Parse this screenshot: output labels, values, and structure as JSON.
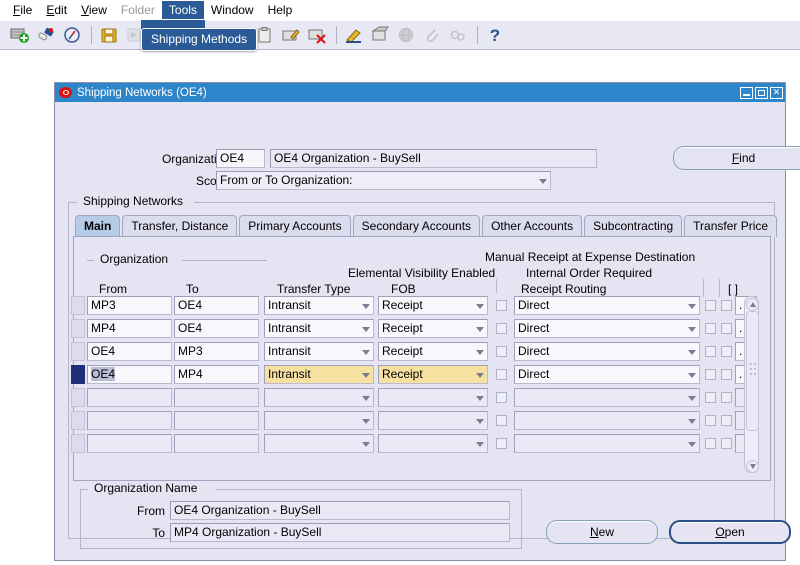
{
  "menubar": {
    "items": [
      {
        "label": "File",
        "state": "normal"
      },
      {
        "label": "Edit",
        "state": "normal"
      },
      {
        "label": "View",
        "state": "normal"
      },
      {
        "label": "Folder",
        "state": "disabled"
      },
      {
        "label": "Tools",
        "state": "active"
      },
      {
        "label": "Window",
        "state": "normal"
      },
      {
        "label": "Help",
        "state": "normal"
      }
    ]
  },
  "tooltip": {
    "text": "Shipping Methods"
  },
  "toolbar": {
    "buttons": [
      {
        "name": "new-record-icon",
        "glyph": "➕",
        "disabled": false
      },
      {
        "name": "find-flashlight-icon",
        "glyph": "ὒ6",
        "disabled": false
      },
      {
        "name": "show-navigator-icon",
        "glyph": "◔",
        "disabled": false
      },
      {
        "name": "separator",
        "glyph": "",
        "disabled": false
      },
      {
        "name": "save-icon",
        "glyph": "ὋE",
        "disabled": false
      },
      {
        "name": "next-step-icon",
        "glyph": "⏩",
        "disabled": true
      },
      {
        "name": "print-icon",
        "glyph": "὚8",
        "disabled": true
      },
      {
        "name": "close-form-icon",
        "glyph": "✖",
        "disabled": true
      },
      {
        "name": "cut-icon",
        "glyph": "✂",
        "disabled": false
      },
      {
        "name": "copy-icon",
        "glyph": "Ὅ1",
        "disabled": false
      },
      {
        "name": "paste-icon",
        "glyph": "ὌB",
        "disabled": false
      },
      {
        "name": "edit-record-icon",
        "glyph": "✏",
        "disabled": false
      },
      {
        "name": "delete-record-icon",
        "glyph": "✖",
        "disabled": false
      },
      {
        "name": "separator",
        "glyph": "",
        "disabled": false
      },
      {
        "name": "edit-field-icon",
        "glyph": "὘A",
        "disabled": false
      },
      {
        "name": "zoom-icon",
        "glyph": "ὐD",
        "disabled": false
      },
      {
        "name": "translations-icon",
        "glyph": "ἱ0",
        "disabled": true
      },
      {
        "name": "attachments-icon",
        "glyph": "ὌE",
        "disabled": true
      },
      {
        "name": "folder-tools-icon",
        "glyph": "⚙",
        "disabled": true
      },
      {
        "name": "separator",
        "glyph": "",
        "disabled": false
      },
      {
        "name": "help-icon",
        "glyph": "?",
        "disabled": false
      }
    ]
  },
  "window": {
    "title": "Shipping Networks (OE4)",
    "controls": {
      "minimize": "–",
      "maximize": "□",
      "close": "✕"
    }
  },
  "header": {
    "organization_label": "Organization",
    "organization_code": "OE4",
    "organization_name": "OE4 Organization - BuySell",
    "scope_label": "Scope",
    "scope_value": "From or To Organization:",
    "find_button": "Find"
  },
  "shipping_networks": {
    "group_title": "Shipping Networks",
    "tabs": [
      {
        "label": "Main",
        "selected": true
      },
      {
        "label": "Transfer, Distance",
        "selected": false
      },
      {
        "label": "Primary Accounts",
        "selected": false
      },
      {
        "label": "Secondary Accounts",
        "selected": false
      },
      {
        "label": "Other Accounts",
        "selected": false
      },
      {
        "label": "Subcontracting",
        "selected": false
      },
      {
        "label": "Transfer Price",
        "selected": false
      }
    ]
  },
  "grid": {
    "org_group_title": "Organization",
    "banner_line1": "Manual Receipt at Expense Destination",
    "banner_line2_left": "Elemental Visibility Enabled",
    "banner_line2_right": "Internal Order Required",
    "columns": {
      "from": "From",
      "to": "To",
      "transfer_type": "Transfer Type",
      "fob": "FOB",
      "receipt_routing": "Receipt Routing",
      "flex": "[ ]"
    },
    "rows": [
      {
        "from": "MP3",
        "to": "OE4",
        "transfer_type": "Intransit",
        "fob": "Receipt",
        "elemental_visibility": false,
        "receipt_routing": "Direct",
        "manual_receipt": false,
        "internal_order": false,
        "flex": ".",
        "current": false,
        "highlighted": false
      },
      {
        "from": "MP4",
        "to": "OE4",
        "transfer_type": "Intransit",
        "fob": "Receipt",
        "elemental_visibility": false,
        "receipt_routing": "Direct",
        "manual_receipt": false,
        "internal_order": false,
        "flex": ".",
        "current": false,
        "highlighted": false
      },
      {
        "from": "OE4",
        "to": "MP3",
        "transfer_type": "Intransit",
        "fob": "Receipt",
        "elemental_visibility": false,
        "receipt_routing": "Direct",
        "manual_receipt": false,
        "internal_order": false,
        "flex": ".",
        "current": false,
        "highlighted": false
      },
      {
        "from": "OE4",
        "to": "MP4",
        "transfer_type": "Intransit",
        "fob": "Receipt",
        "elemental_visibility": false,
        "receipt_routing": "Direct",
        "manual_receipt": false,
        "internal_order": false,
        "flex": ".",
        "current": true,
        "highlighted": true
      },
      {
        "from": "",
        "to": "",
        "transfer_type": "",
        "fob": "",
        "elemental_visibility": false,
        "receipt_routing": "",
        "manual_receipt": false,
        "internal_order": false,
        "flex": "",
        "current": false,
        "highlighted": false
      },
      {
        "from": "",
        "to": "",
        "transfer_type": "",
        "fob": "",
        "elemental_visibility": false,
        "receipt_routing": "",
        "manual_receipt": false,
        "internal_order": false,
        "flex": "",
        "current": false,
        "highlighted": false
      },
      {
        "from": "",
        "to": "",
        "transfer_type": "",
        "fob": "",
        "elemental_visibility": false,
        "receipt_routing": "",
        "manual_receipt": false,
        "internal_order": false,
        "flex": "",
        "current": false,
        "highlighted": false
      }
    ]
  },
  "org_name": {
    "group_title": "Organization Name",
    "from_label": "From",
    "from_value": "OE4 Organization - BuySell",
    "to_label": "To",
    "to_value": "MP4 Organization - BuySell"
  },
  "footer": {
    "new_button": "New",
    "open_button": "Open"
  },
  "colors": {
    "titlebar": "#2d86c9",
    "window_bg": "#e4e4f2",
    "tab_selected": "#b6cbe6",
    "highlight_field": "#f7e1a0",
    "current_row": "#1c2f77",
    "menu_active": "#2a5b96"
  }
}
